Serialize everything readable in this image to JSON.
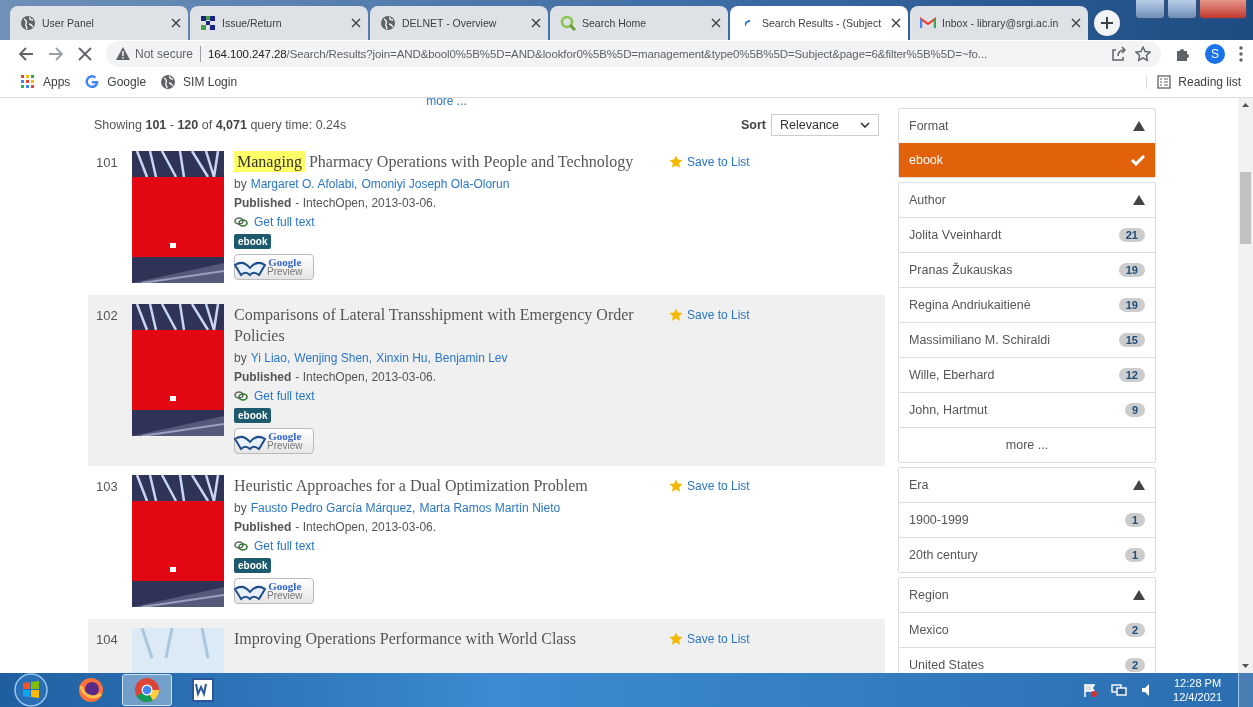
{
  "browser": {
    "tabs": [
      {
        "title": "User Panel",
        "selected": false
      },
      {
        "title": "Issue/Return",
        "selected": false
      },
      {
        "title": "DELNET - Overview",
        "selected": false
      },
      {
        "title": "Search Home",
        "selected": false
      },
      {
        "title": "Search Results - (Subject",
        "selected": true
      },
      {
        "title": "Inbox - library@srgi.ac.in",
        "selected": false
      }
    ],
    "security": "Not secure",
    "url_host": "164.100.247.28",
    "url_path": "/Search/Results?join=AND&bool0%5B%5D=AND&lookfor0%5B%5D=management&type0%5B%5D=Subject&page=6&filter%5B%5D=~fo...",
    "profile": "S",
    "bookmarks": [
      {
        "label": "Apps"
      },
      {
        "label": "Google"
      },
      {
        "label": "SIM Login"
      }
    ],
    "reading_list": "Reading list"
  },
  "page": {
    "top_more": "more ...",
    "summary": "Showing **101** - **120** of **4,071** query time: 0.24s",
    "sort_label": "Sort",
    "sort_value": "Relevance",
    "results": [
      {
        "number": "101",
        "title_highlight": "Managing",
        "title": "Pharmacy Operations with People and Technology",
        "by": "by",
        "authors": [
          "Margaret O. Afolabi,",
          "Omoniyi Joseph Ola-Olorun"
        ],
        "published_label": "Published",
        "published": " - IntechOpen, 2013-03-06.",
        "full_text": "Get full text",
        "format": "ebook",
        "preview_top": "Google",
        "preview_bottom": "Preview",
        "save": "Save to List",
        "shaded": false
      },
      {
        "number": "102",
        "title": "Comparisons of Lateral Transshipment with Emergency Order Policies",
        "by": "by",
        "authors": [
          "Yi Liao,",
          "Wenjing Shen,",
          "Xinxin Hu,",
          "Benjamin Lev"
        ],
        "published_label": "Published",
        "published": " - IntechOpen, 2013-03-06.",
        "full_text": "Get full text",
        "format": "ebook",
        "preview_top": "Google",
        "preview_bottom": "Preview",
        "save": "Save to List",
        "shaded": true
      },
      {
        "number": "103",
        "title": "Heuristic Approaches for a Dual Optimization Problem",
        "by": "by",
        "authors": [
          "Fausto Pedro García Márquez,",
          "Marta Ramos Martín Nieto"
        ],
        "published_label": "Published",
        "published": " - IntechOpen, 2013-03-06.",
        "full_text": "Get full text",
        "format": "ebook",
        "preview_top": "Google",
        "preview_bottom": "Preview",
        "save": "Save to List",
        "shaded": false
      },
      {
        "number": "104",
        "title": "Improving Operations Performance with World Class",
        "save": "Save to List",
        "shaded": true
      }
    ],
    "facets": [
      {
        "title": "Format",
        "expanded": true,
        "items": [
          {
            "label": "ebook",
            "selected": true
          }
        ]
      },
      {
        "title": "Author",
        "expanded": true,
        "items": [
          {
            "label": "Jolita Vveinhardt",
            "count": "21",
            "selected": false
          },
          {
            "label": "Pranas Žukauskas",
            "count": "19",
            "selected": false
          },
          {
            "label": "Regina Andriukaitienė",
            "count": "19",
            "selected": false
          },
          {
            "label": "Massimiliano M. Schiraldi",
            "count": "15",
            "selected": false
          },
          {
            "label": "Wille, Eberhard",
            "count": "12",
            "selected": false
          },
          {
            "label": "John, Hartmut",
            "count": "9",
            "selected": false
          }
        ],
        "more": "more ..."
      },
      {
        "title": "Era",
        "expanded": true,
        "items": [
          {
            "label": "1900-1999",
            "count": "1",
            "selected": false
          },
          {
            "label": "20th century",
            "count": "1",
            "selected": false
          }
        ]
      },
      {
        "title": "Region",
        "expanded": true,
        "items": [
          {
            "label": "Mexico",
            "count": "2",
            "selected": false
          },
          {
            "label": "United States",
            "count": "2",
            "selected": false
          }
        ]
      }
    ]
  },
  "taskbar": {
    "apps": [
      {
        "kind": "firefox",
        "active": false
      },
      {
        "kind": "chrome",
        "active": true
      },
      {
        "kind": "word",
        "active": false
      }
    ],
    "time": "12:28 PM",
    "date": "12/4/2021"
  }
}
